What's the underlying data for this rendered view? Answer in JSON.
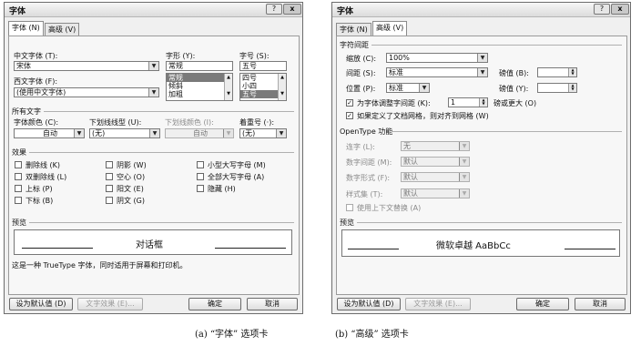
{
  "left": {
    "title": "字体",
    "help": "?",
    "close": "x",
    "tabs": [
      "字体 (N)",
      "高级 (V)"
    ],
    "cn_font_label": "中文字体 (T):",
    "cn_font_value": "宋体",
    "style_label": "字形 (Y):",
    "style_value": "常规",
    "style_items": [
      "常规",
      "倾斜",
      "加粗"
    ],
    "size_label": "字号 (S):",
    "size_value": "五号",
    "size_items": [
      "四号",
      "小四",
      "五号"
    ],
    "west_font_label": "西文字体 (F):",
    "west_font_value": "(使用中文字体)",
    "all_text": "所有文字",
    "color_label": "字体颜色 (C):",
    "color_value": "自动",
    "underline_label": "下划线线型 (U):",
    "underline_value": "(无)",
    "ucolor_label": "下划线颜色 (I):",
    "ucolor_value": "自动",
    "emph_label": "着重号 (·):",
    "emph_value": "(无)",
    "effects": "效果",
    "fx": [
      "删除线 (K)",
      "双删除线 (L)",
      "上标 (P)",
      "下标 (B)",
      "阴影 (W)",
      "空心 (O)",
      "阳文 (E)",
      "阴文 (G)",
      "小型大写字母 (M)",
      "全部大写字母 (A)",
      "隐藏 (H)"
    ],
    "preview": "预览",
    "preview_text": "对话框",
    "note": "这是一种 TrueType 字体，同时适用于屏幕和打印机。",
    "btn_default": "设为默认值 (D)",
    "btn_texteffects": "文字效果 (E)...",
    "btn_ok": "确定",
    "btn_cancel": "取消"
  },
  "right": {
    "title": "字体",
    "help": "?",
    "close": "x",
    "tabs": [
      "字体 (N)",
      "高级 (V)"
    ],
    "char_spacing": "字符间距",
    "scale_label": "缩放 (C):",
    "scale_value": "100%",
    "spacing_label": "间距 (S):",
    "spacing_value": "标准",
    "spacing_by_label": "磅值 (B):",
    "position_label": "位置 (P):",
    "position_value": "标准",
    "position_by_label": "磅值 (Y):",
    "kerning_label": "为字体调整字间距 (K):",
    "kerning_value": "1",
    "kerning_suffix": "磅或更大 (O)",
    "grid_label": "如果定义了文档网格，则对齐到网格 (W)",
    "opentype": "OpenType 功能",
    "lig_label": "连字 (L):",
    "lig_value": "无",
    "numsp_label": "数字间距 (M):",
    "numsp_value": "默认",
    "numform_label": "数字形式 (F):",
    "numform_value": "默认",
    "styleset_label": "样式集 (T):",
    "styleset_value": "默认",
    "ctx_label": "使用上下文替换 (A)",
    "preview": "预览",
    "preview_text": "微软卓越 AaBbCc",
    "btn_default": "设为默认值 (D)",
    "btn_texteffects": "文字效果 (E)...",
    "btn_ok": "确定",
    "btn_cancel": "取消"
  },
  "captions": {
    "a": "(a) “字体” 选项卡",
    "b": "(b) “高级” 选项卡"
  }
}
